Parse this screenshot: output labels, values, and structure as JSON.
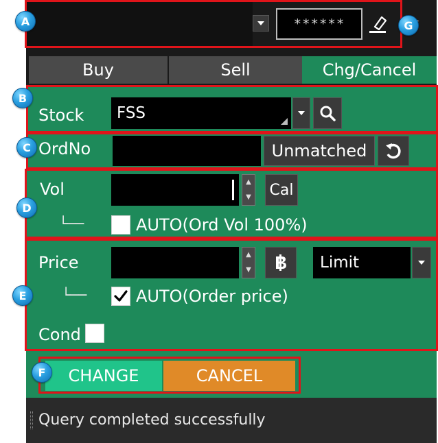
{
  "account": {
    "password_mask": "******"
  },
  "tabs": [
    {
      "label": "Buy"
    },
    {
      "label": "Sell"
    },
    {
      "label": "Chg/Cancel"
    }
  ],
  "stock": {
    "label": "Stock",
    "value": "FSS"
  },
  "order_no": {
    "label": "OrdNo",
    "value": "",
    "unmatched_label": "Unmatched"
  },
  "volume": {
    "label": "Vol",
    "value": "",
    "calc_label": "Cal",
    "tree_glyph": "└──",
    "auto_label": "AUTO(Ord Vol 100%)",
    "auto_checked": false
  },
  "price": {
    "label": "Price",
    "value": "",
    "type_value": "Limit",
    "tree_glyph": "└──",
    "auto_label": "AUTO(Order price)",
    "auto_checked": true,
    "cond_label": "Cond",
    "cond_checked": false
  },
  "actions": {
    "change_label": "CHANGE",
    "cancel_label": "CANCEL"
  },
  "status": {
    "message": "Query completed successfully"
  },
  "markers": [
    "A",
    "B",
    "C",
    "D",
    "E",
    "F",
    "G"
  ],
  "colors": {
    "panel_green": "#1e8a5a",
    "change_button": "#20c48a",
    "cancel_button": "#e08a28",
    "highlight_border": "#e0141a",
    "marker_blue": "#2a9fe0"
  }
}
